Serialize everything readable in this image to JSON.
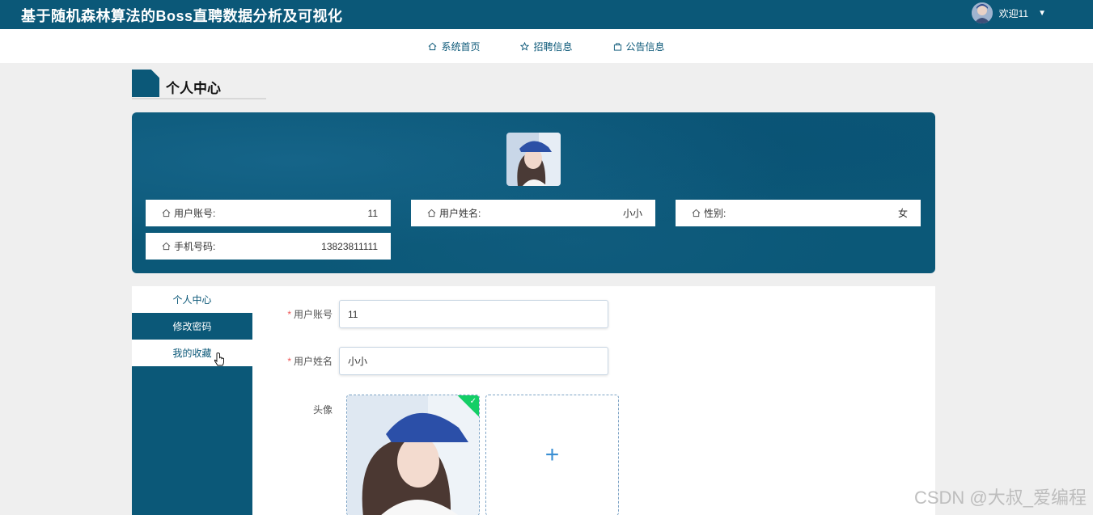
{
  "header": {
    "site_title": "基于随机森林算法的Boss直聘数据分析及可视化",
    "welcome": "欢迎11"
  },
  "nav": {
    "items": [
      {
        "label": "系统首页",
        "icon": "home-icon"
      },
      {
        "label": "招聘信息",
        "icon": "star-icon"
      },
      {
        "label": "公告信息",
        "icon": "bag-icon"
      }
    ]
  },
  "page": {
    "title": "个人中心"
  },
  "profile": {
    "fields": [
      {
        "label": "用户账号:",
        "value": "11"
      },
      {
        "label": "用户姓名:",
        "value": "小小"
      },
      {
        "label": "性别:",
        "value": "女"
      },
      {
        "label": "手机号码:",
        "value": "13823811111"
      }
    ]
  },
  "sidemenu": {
    "items": [
      "个人中心",
      "修改密码",
      "我的收藏"
    ],
    "active": "修改密码"
  },
  "form": {
    "account_label": "用户账号",
    "account_value": "11",
    "name_label": "用户姓名",
    "name_value": "小小",
    "avatar_label": "头像",
    "required_mark": "*"
  },
  "watermark": "CSDN @大叔_爱编程",
  "colors": {
    "primary": "#0b5878",
    "success": "#13ce66",
    "accent": "#3b8fd3"
  }
}
